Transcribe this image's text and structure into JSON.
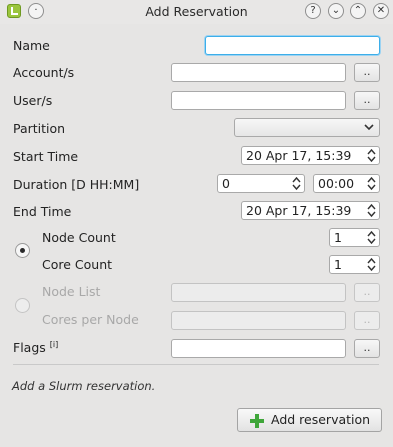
{
  "window": {
    "title": "Add Reservation"
  },
  "titlebar_buttons": {
    "help": "?",
    "minimize": "⌄",
    "maximize": "⌃",
    "close": "✕",
    "menu": "·"
  },
  "form": {
    "name_label": "Name",
    "accounts_label": "Account/s",
    "users_label": "User/s",
    "partition_label": "Partition",
    "start_time_label": "Start Time",
    "duration_label": "Duration [D HH:MM]",
    "end_time_label": "End Time",
    "node_count_label": "Node Count",
    "core_count_label": "Core Count",
    "node_list_label": "Node List",
    "cores_per_node_label": "Cores per Node",
    "flags_label": "Flags",
    "flags_superscript": "[i]",
    "browse_label": "..",
    "name_value": "",
    "accounts_value": "",
    "users_value": "",
    "partition_value": "",
    "start_time_value": "20 Apr 17, 15:39",
    "duration_days_value": "0",
    "duration_time_value": "00:00",
    "end_time_value": "20 Apr 17, 15:39",
    "node_count_value": "1",
    "core_count_value": "1",
    "node_list_value": "",
    "cores_per_node_value": "",
    "flags_value": "",
    "selected_mode": "node-count"
  },
  "status_text": "Add a Slurm reservation.",
  "add_button_label": "Add reservation",
  "colors": {
    "accent": "#3daee9",
    "plus_green": "#3fa63a"
  }
}
